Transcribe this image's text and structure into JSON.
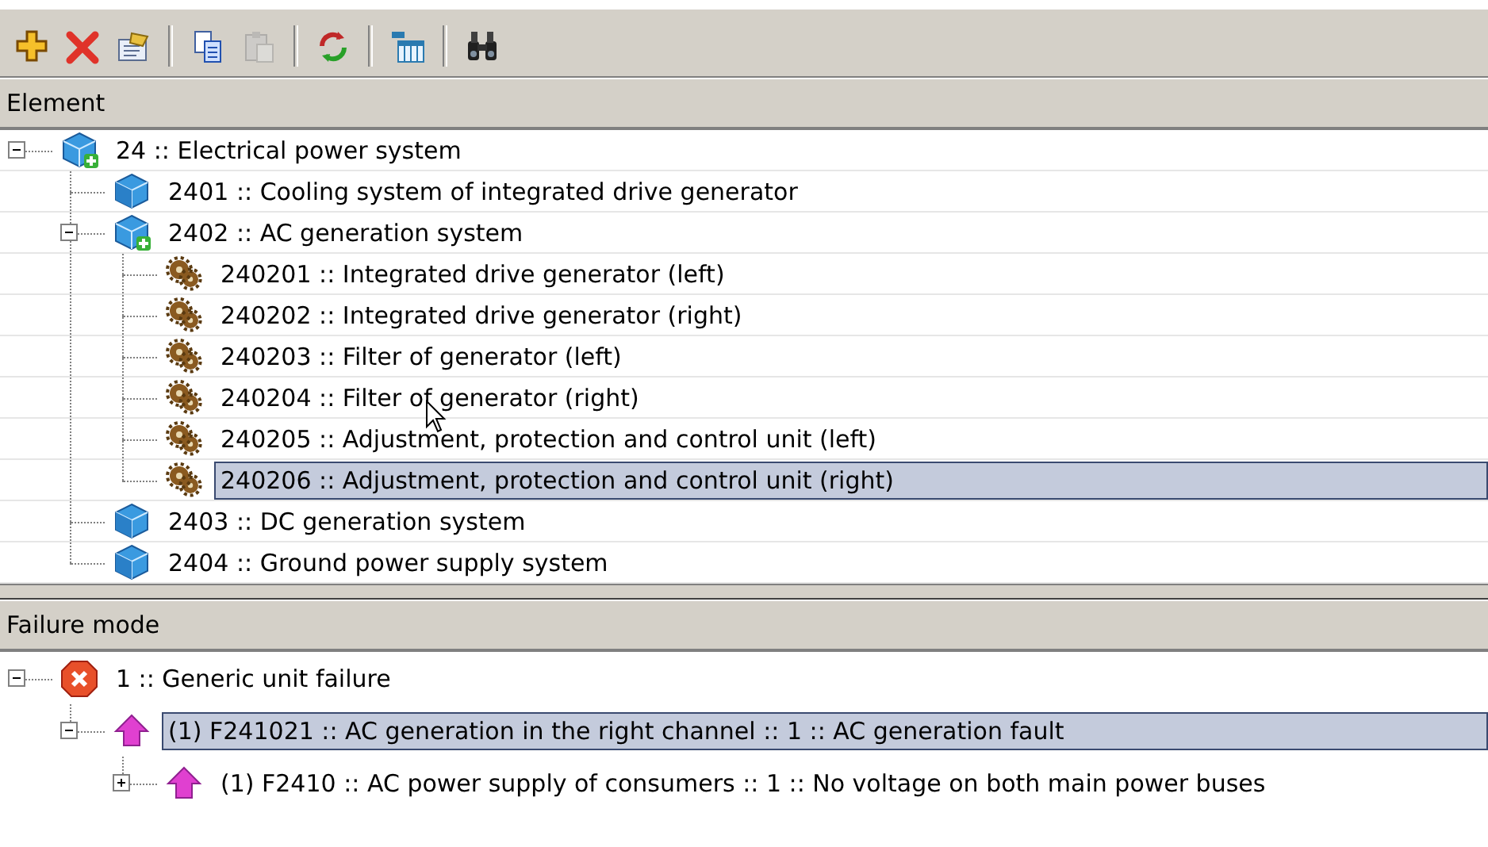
{
  "toolbar": [
    {
      "kind": "add",
      "disabled": false
    },
    {
      "kind": "delete",
      "disabled": false
    },
    {
      "kind": "properties",
      "disabled": false
    },
    {
      "kind": "separator"
    },
    {
      "kind": "copy",
      "disabled": false
    },
    {
      "kind": "paste",
      "disabled": true
    },
    {
      "kind": "separator"
    },
    {
      "kind": "refresh",
      "disabled": false
    },
    {
      "kind": "separator"
    },
    {
      "kind": "columns",
      "disabled": false
    },
    {
      "kind": "separator"
    },
    {
      "kind": "find",
      "disabled": false
    }
  ],
  "element_pane": {
    "title": "Element",
    "items": [
      {
        "kind": "group",
        "label": "24 :: Electrical power system",
        "expanded": true,
        "selected": false,
        "children": [
          {
            "kind": "system",
            "label": "2401 :: Cooling system of integrated drive generator",
            "selected": false
          },
          {
            "kind": "group",
            "label": "2402 :: AC generation system",
            "expanded": true,
            "selected": false,
            "children": [
              {
                "kind": "unit",
                "label": "240201 :: Integrated drive generator (left)",
                "selected": false
              },
              {
                "kind": "unit",
                "label": "240202 :: Integrated drive generator (right)",
                "selected": false
              },
              {
                "kind": "unit",
                "label": "240203 :: Filter of generator (left)",
                "selected": false
              },
              {
                "kind": "unit",
                "label": "240204 :: Filter of generator (right)",
                "selected": false
              },
              {
                "kind": "unit",
                "label": "240205 :: Adjustment, protection and control unit (left)",
                "selected": false
              },
              {
                "kind": "unit",
                "label": "240206 :: Adjustment, protection and control unit (right)",
                "selected": true
              }
            ]
          },
          {
            "kind": "system",
            "label": "2403 :: DC generation system",
            "selected": false
          },
          {
            "kind": "system",
            "label": "2404 :: Ground power supply system",
            "selected": false
          }
        ]
      }
    ]
  },
  "failure_pane": {
    "title": "Failure mode",
    "items": [
      {
        "kind": "failure",
        "label": "1 :: Generic unit failure",
        "expanded": true,
        "selected": false,
        "children": [
          {
            "kind": "effect",
            "label": "(1) F241021 :: AC generation in the right channel :: 1 :: AC generation fault",
            "expanded": true,
            "selected": true,
            "children": [
              {
                "kind": "effect",
                "label": "(1) F2410 :: AC power supply of consumers :: 1 :: No voltage on both main power buses",
                "expanded": false,
                "selected": false
              }
            ]
          }
        ]
      }
    ]
  }
}
